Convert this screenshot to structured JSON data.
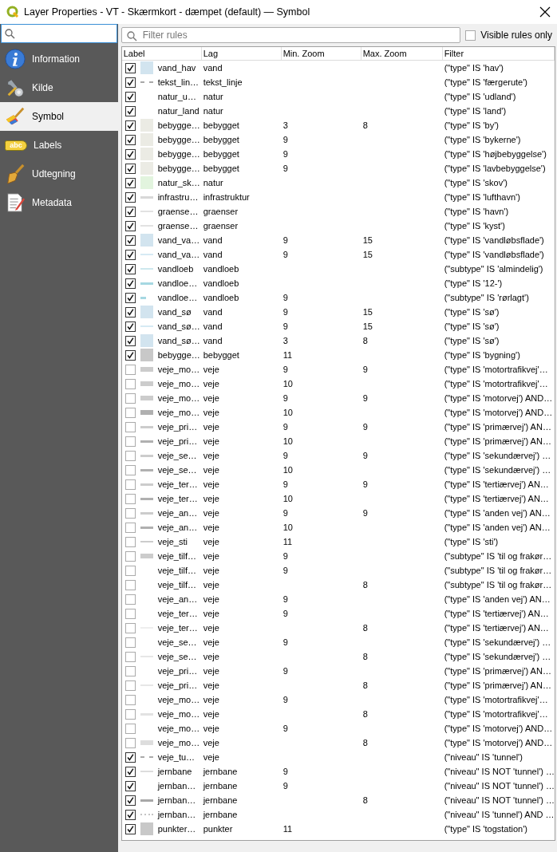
{
  "window": {
    "title": "Layer Properties - VT - Skærmkort - dæmpet (default) — Symbol"
  },
  "sidebar": {
    "items": [
      {
        "label": "Information",
        "selected": false
      },
      {
        "label": "Kilde",
        "selected": false
      },
      {
        "label": "Symbol",
        "selected": true
      },
      {
        "label": "Labels",
        "icon_text": "abc",
        "selected": false
      },
      {
        "label": "Udtegning",
        "selected": false
      },
      {
        "label": "Metadata",
        "selected": false
      }
    ]
  },
  "filter": {
    "placeholder": "Filter rules"
  },
  "visible_only": {
    "label": "Visible rules only",
    "checked": false
  },
  "table": {
    "columns": [
      "Label",
      "Lag",
      "Min. Zoom",
      "Max. Zoom",
      "Filter"
    ],
    "rows": [
      {
        "checked": true,
        "symbol": {
          "kind": "fill",
          "color": "#d2e4ef"
        },
        "label": "vand_hav",
        "lag": "vand",
        "filter": "(\"type\" IS 'hav')"
      },
      {
        "checked": true,
        "symbol": {
          "kind": "dash",
          "color": "#a8a8a8"
        },
        "label": "tekst_lin…",
        "lag": "tekst_linje",
        "filter": "(\"type\" IS 'færgerute')"
      },
      {
        "checked": true,
        "label": "natur_u…",
        "lag": "natur",
        "filter": "(\"type\" IS 'udland')"
      },
      {
        "checked": true,
        "label": "natur_land",
        "lag": "natur",
        "filter": "(\"type\" IS 'land')"
      },
      {
        "checked": true,
        "symbol": {
          "kind": "fill",
          "color": "#ebebe4"
        },
        "label": "bebygge…",
        "lag": "bebygget",
        "min_zoom": "3",
        "max_zoom": "8",
        "filter": "(\"type\" IS 'by')"
      },
      {
        "checked": true,
        "symbol": {
          "kind": "fill",
          "color": "#ebebe4"
        },
        "label": "bebygge…",
        "lag": "bebygget",
        "min_zoom": "9",
        "filter": "(\"type\" IS 'bykerne')"
      },
      {
        "checked": true,
        "symbol": {
          "kind": "fill",
          "color": "#ebebe4"
        },
        "label": "bebygge…",
        "lag": "bebygget",
        "min_zoom": "9",
        "filter": "(\"type\" IS 'højbebyggelse')"
      },
      {
        "checked": true,
        "symbol": {
          "kind": "fill",
          "color": "#ebebe4"
        },
        "label": "bebygge…",
        "lag": "bebygget",
        "min_zoom": "9",
        "filter": "(\"type\" IS 'lavbebyggelse')"
      },
      {
        "checked": true,
        "symbol": {
          "kind": "fill",
          "color": "#e2f4de"
        },
        "label": "natur_sk…",
        "lag": "natur",
        "filter": "(\"type\" IS 'skov')"
      },
      {
        "checked": true,
        "symbol": {
          "kind": "bar",
          "color": "#d8d8d8"
        },
        "label": "infrastru…",
        "lag": "infrastruktur",
        "filter": "(\"type\" IS 'lufthavn')"
      },
      {
        "checked": true,
        "symbol": {
          "kind": "line",
          "color": "#e2e2e2"
        },
        "label": "graense…",
        "lag": "graenser",
        "filter": "(\"type\" IS 'havn')"
      },
      {
        "checked": true,
        "symbol": {
          "kind": "line",
          "color": "#e2e2e2"
        },
        "label": "graense…",
        "lag": "graenser",
        "filter": "(\"type\" IS 'kyst')"
      },
      {
        "checked": true,
        "symbol": {
          "kind": "fill",
          "color": "#d2e4ef"
        },
        "label": "vand_va…",
        "lag": "vand",
        "min_zoom": "9",
        "max_zoom": "15",
        "filter": "(\"type\" IS 'vandløbsflade')"
      },
      {
        "checked": true,
        "symbol": {
          "kind": "line",
          "color": "#d6eaf4"
        },
        "label": "vand_va…",
        "lag": "vand",
        "min_zoom": "9",
        "max_zoom": "15",
        "filter": "(\"type\" IS 'vandløbsflade')"
      },
      {
        "checked": true,
        "symbol": {
          "kind": "line",
          "color": "#cde8ee"
        },
        "label": "vandloeb",
        "lag": "vandloeb",
        "filter": "(\"subtype\" IS 'almindelig')"
      },
      {
        "checked": true,
        "symbol": {
          "kind": "bar",
          "color": "#a6d8e2"
        },
        "label": "vandloe…",
        "lag": "vandloeb",
        "filter": "(\"type\" IS '12-')"
      },
      {
        "checked": true,
        "symbol": {
          "kind": "stub",
          "color": "#a6d8e2"
        },
        "label": "vandloe…",
        "lag": "vandloeb",
        "min_zoom": "9",
        "filter": "(\"subtype\" IS 'rørlagt')"
      },
      {
        "checked": true,
        "symbol": {
          "kind": "fill",
          "color": "#d2e4ef"
        },
        "label": "vand_sø",
        "lag": "vand",
        "min_zoom": "9",
        "max_zoom": "15",
        "filter": "(\"type\" IS 'sø')"
      },
      {
        "checked": true,
        "symbol": {
          "kind": "line",
          "color": "#d6eaf4"
        },
        "label": "vand_sø…",
        "lag": "vand",
        "min_zoom": "9",
        "max_zoom": "15",
        "filter": "(\"type\" IS 'sø')"
      },
      {
        "checked": true,
        "symbol": {
          "kind": "fill",
          "color": "#d2e4ef"
        },
        "label": "vand_sø…",
        "lag": "vand",
        "min_zoom": "3",
        "max_zoom": "8",
        "filter": "(\"type\" IS 'sø')"
      },
      {
        "checked": true,
        "symbol": {
          "kind": "fill",
          "color": "#c8c8c8"
        },
        "label": "bebygge…",
        "lag": "bebygget",
        "min_zoom": "11",
        "filter": "(\"type\" IS 'bygning')"
      },
      {
        "checked": false,
        "symbol": {
          "kind": "wide",
          "color": "#cccccc"
        },
        "label": "veje_mo…",
        "lag": "veje",
        "min_zoom": "9",
        "max_zoom": "9",
        "filter": "(\"type\" IS 'motortrafikvej'…"
      },
      {
        "checked": false,
        "symbol": {
          "kind": "wide",
          "color": "#cccccc"
        },
        "label": "veje_mo…",
        "lag": "veje",
        "min_zoom": "10",
        "filter": "(\"type\" IS 'motortrafikvej'…"
      },
      {
        "checked": false,
        "symbol": {
          "kind": "wide",
          "color": "#cccccc"
        },
        "label": "veje_mo…",
        "lag": "veje",
        "min_zoom": "9",
        "max_zoom": "9",
        "filter": "(\"type\" IS 'motorvej') AND…"
      },
      {
        "checked": false,
        "symbol": {
          "kind": "wide",
          "color": "#b0b0b0"
        },
        "label": "veje_mo…",
        "lag": "veje",
        "min_zoom": "10",
        "filter": "(\"type\" IS 'motorvej') AND…"
      },
      {
        "checked": false,
        "symbol": {
          "kind": "bar",
          "color": "#cccccc"
        },
        "label": "veje_pri…",
        "lag": "veje",
        "min_zoom": "9",
        "max_zoom": "9",
        "filter": "(\"type\" IS 'primærvej') AN…"
      },
      {
        "checked": false,
        "symbol": {
          "kind": "bar",
          "color": "#b0b0b0"
        },
        "label": "veje_pri…",
        "lag": "veje",
        "min_zoom": "10",
        "filter": "(\"type\" IS 'primærvej') AN…"
      },
      {
        "checked": false,
        "symbol": {
          "kind": "bar",
          "color": "#cccccc"
        },
        "label": "veje_se…",
        "lag": "veje",
        "min_zoom": "9",
        "max_zoom": "9",
        "filter": "(\"type\" IS 'sekundærvej') …"
      },
      {
        "checked": false,
        "symbol": {
          "kind": "bar",
          "color": "#b0b0b0"
        },
        "label": "veje_se…",
        "lag": "veje",
        "min_zoom": "10",
        "filter": "(\"type\" IS 'sekundærvej') …"
      },
      {
        "checked": false,
        "symbol": {
          "kind": "bar",
          "color": "#cccccc"
        },
        "label": "veje_ter…",
        "lag": "veje",
        "min_zoom": "9",
        "max_zoom": "9",
        "filter": "(\"type\" IS 'tertiærvej') AN…"
      },
      {
        "checked": false,
        "symbol": {
          "kind": "bar",
          "color": "#b0b0b0"
        },
        "label": "veje_ter…",
        "lag": "veje",
        "min_zoom": "10",
        "filter": "(\"type\" IS 'tertiærvej') AN…"
      },
      {
        "checked": false,
        "symbol": {
          "kind": "bar",
          "color": "#cccccc"
        },
        "label": "veje_an…",
        "lag": "veje",
        "min_zoom": "9",
        "max_zoom": "9",
        "filter": "(\"type\" IS 'anden vej') AN…"
      },
      {
        "checked": false,
        "symbol": {
          "kind": "bar",
          "color": "#b0b0b0"
        },
        "label": "veje_an…",
        "lag": "veje",
        "min_zoom": "10",
        "filter": "(\"type\" IS 'anden vej') AN…"
      },
      {
        "checked": false,
        "symbol": {
          "kind": "line",
          "color": "#cccccc"
        },
        "label": "veje_sti",
        "lag": "veje",
        "min_zoom": "11",
        "filter": "(\"type\" IS 'sti')"
      },
      {
        "checked": false,
        "symbol": {
          "kind": "wide",
          "color": "#cccccc"
        },
        "label": "veje_tilf…",
        "lag": "veje",
        "min_zoom": "9",
        "filter": "(\"subtype\" IS 'til og frakør…"
      },
      {
        "checked": false,
        "label": "veje_tilf…",
        "lag": "veje",
        "min_zoom": "9",
        "filter": "(\"subtype\" IS 'til og frakør…"
      },
      {
        "checked": false,
        "label": "veje_tilf…",
        "lag": "veje",
        "max_zoom": "8",
        "filter": "(\"subtype\" IS 'til og frakør…"
      },
      {
        "checked": false,
        "label": "veje_an…",
        "lag": "veje",
        "min_zoom": "9",
        "filter": "(\"type\" IS 'anden vej') AN…"
      },
      {
        "checked": false,
        "label": "veje_ter…",
        "lag": "veje",
        "min_zoom": "9",
        "filter": "(\"type\" IS 'tertiærvej') AN…"
      },
      {
        "checked": false,
        "symbol": {
          "kind": "line",
          "color": "#eeeeee"
        },
        "label": "veje_ter…",
        "lag": "veje",
        "max_zoom": "8",
        "filter": "(\"type\" IS 'tertiærvej') AN…"
      },
      {
        "checked": false,
        "label": "veje_se…",
        "lag": "veje",
        "min_zoom": "9",
        "filter": "(\"type\" IS 'sekundærvej') …"
      },
      {
        "checked": false,
        "symbol": {
          "kind": "line",
          "color": "#e6e6e6"
        },
        "label": "veje_se…",
        "lag": "veje",
        "max_zoom": "8",
        "filter": "(\"type\" IS 'sekundærvej') …"
      },
      {
        "checked": false,
        "label": "veje_pri…",
        "lag": "veje",
        "min_zoom": "9",
        "filter": "(\"type\" IS 'primærvej') AN…"
      },
      {
        "checked": false,
        "symbol": {
          "kind": "line",
          "color": "#e6e6e6"
        },
        "label": "veje_pri…",
        "lag": "veje",
        "max_zoom": "8",
        "filter": "(\"type\" IS 'primærvej') AN…"
      },
      {
        "checked": false,
        "label": "veje_mo…",
        "lag": "veje",
        "min_zoom": "9",
        "filter": "(\"type\" IS 'motortrafikvej'…"
      },
      {
        "checked": false,
        "symbol": {
          "kind": "bar",
          "color": "#e2e2e2"
        },
        "label": "veje_mo…",
        "lag": "veje",
        "max_zoom": "8",
        "filter": "(\"type\" IS 'motortrafikvej'…"
      },
      {
        "checked": false,
        "label": "veje_mo…",
        "lag": "veje",
        "min_zoom": "9",
        "filter": "(\"type\" IS 'motorvej') AND…"
      },
      {
        "checked": false,
        "symbol": {
          "kind": "wide",
          "color": "#dddddd"
        },
        "label": "veje_mo…",
        "lag": "veje",
        "max_zoom": "8",
        "filter": "(\"type\" IS 'motorvej') AND…"
      },
      {
        "checked": true,
        "symbol": {
          "kind": "dash",
          "color": "#aaaaaa"
        },
        "label": "veje_tu…",
        "lag": "veje",
        "filter": "(\"niveau\" IS 'tunnel')"
      },
      {
        "checked": true,
        "symbol": {
          "kind": "line",
          "color": "#dcdcdc"
        },
        "label": "jernbane",
        "lag": "jernbane",
        "min_zoom": "9",
        "filter": "(\"niveau\" IS NOT 'tunnel') …"
      },
      {
        "checked": true,
        "label": "jernban…",
        "lag": "jernbane",
        "min_zoom": "9",
        "filter": "(\"niveau\" IS NOT 'tunnel') …"
      },
      {
        "checked": true,
        "symbol": {
          "kind": "bar",
          "color": "#a8a8a8"
        },
        "label": "jernban…",
        "lag": "jernbane",
        "max_zoom": "8",
        "filter": "(\"niveau\" IS NOT 'tunnel') …"
      },
      {
        "checked": true,
        "symbol": {
          "kind": "dots",
          "color": "#c4c4c4"
        },
        "label": "jernban…",
        "lag": "jernbane",
        "filter": "(\"niveau\" IS 'tunnel') AND …"
      },
      {
        "checked": true,
        "symbol": {
          "kind": "fill",
          "color": "#c8c8c8"
        },
        "label": "punkter…",
        "lag": "punkter",
        "min_zoom": "11",
        "filter": "(\"type\" IS 'togstation')"
      }
    ]
  }
}
